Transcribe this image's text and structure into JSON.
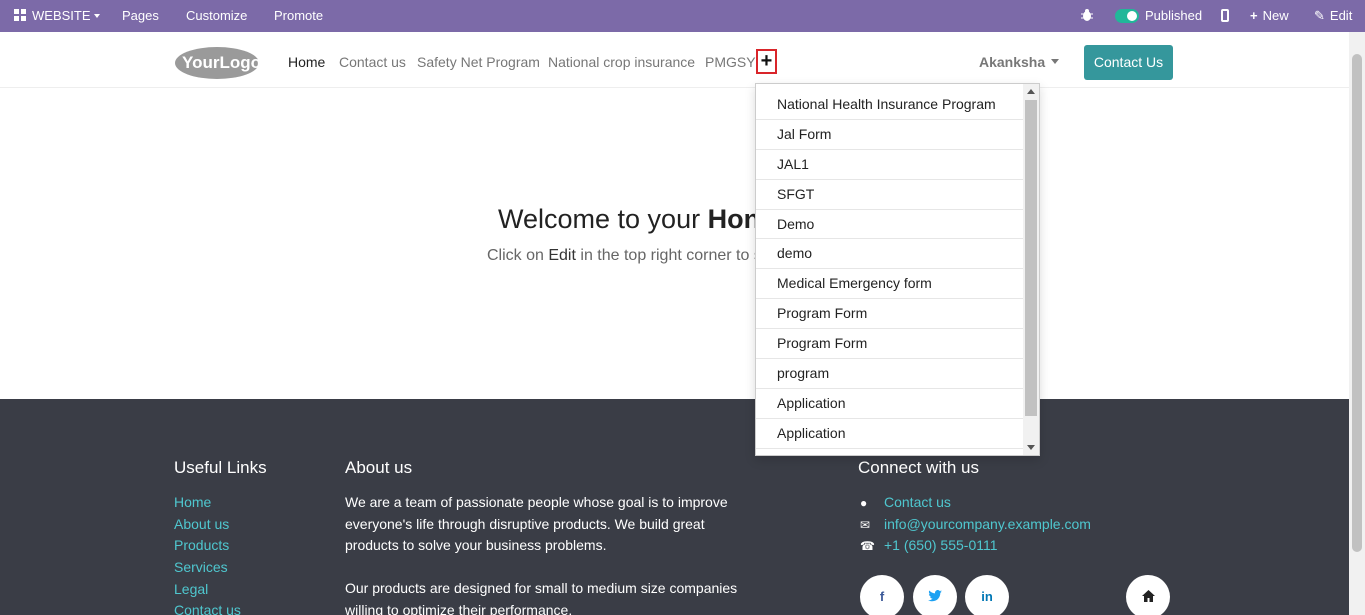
{
  "adminbar": {
    "website_label": "WEBSITE",
    "pages_label": "Pages",
    "customize_label": "Customize",
    "promote_label": "Promote",
    "published_label": "Published",
    "new_label": "New",
    "edit_label": "Edit"
  },
  "header": {
    "logo_text": "YourLogo",
    "nav": [
      "Home",
      "Contact us",
      "Safety Net Program",
      "National crop insurance",
      "PMGSY"
    ],
    "plus_symbol": "+",
    "user_name": "Akanksha",
    "contact_button": "Contact Us"
  },
  "dropdown": {
    "items": [
      "National Health Insurance Program",
      "Jal Form",
      "JAL1",
      "SFGT",
      "Demo",
      "demo",
      "Medical Emergency form",
      "Program Form",
      "Program Form",
      "program",
      "Application",
      "Application"
    ]
  },
  "hero": {
    "title_prefix": "Welcome to your ",
    "title_bold": "Hon",
    "subtitle_prefix": "Click on ",
    "subtitle_edit": "Edit",
    "subtitle_suffix": " in the top right corner to s"
  },
  "footer": {
    "useful_links_title": "Useful Links",
    "links": [
      "Home",
      "About us",
      "Products",
      "Services",
      "Legal",
      "Contact us"
    ],
    "about_title": "About us",
    "about_p1": "We are a team of passionate people whose goal is to improve everyone's life through disruptive products. We build great products to solve your business problems.",
    "about_p2": "Our products are designed for small to medium size companies willing to optimize their performance.",
    "connect_title": "Connect with us",
    "contact_link": "Contact us",
    "email": "info@yourcompany.example.com",
    "phone": "+1 (650) 555-0111",
    "social": [
      "f",
      "t",
      "in",
      "home"
    ]
  },
  "colors": {
    "adminbar": "#7c6aa8",
    "accent": "#35979c",
    "footer_bg": "#3a3d46",
    "link": "#4fc7cf",
    "highlight_border": "#d9252a"
  }
}
